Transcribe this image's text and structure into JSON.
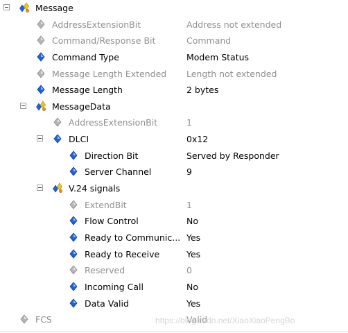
{
  "watermark": "https://blog.csdn.net/XiaoXiaoPengBo",
  "rows": [
    {
      "label": "Message",
      "value": "",
      "icon": "group-icon",
      "dim": false,
      "expander": true
    },
    {
      "label": "AddressExtensionBit",
      "value": "Address not extended",
      "icon": "gray-diamond-icon",
      "dim": true
    },
    {
      "label": "Command/Response Bit",
      "value": "Command",
      "icon": "gray-diamond-icon",
      "dim": true
    },
    {
      "label": "Command Type",
      "value": "Modem Status",
      "icon": "blue-diamond-icon",
      "dim": false
    },
    {
      "label": "Message Length Extended",
      "value": "Length not extended",
      "icon": "gray-diamond-icon",
      "dim": true
    },
    {
      "label": "Message Length",
      "value": "2 bytes",
      "icon": "blue-diamond-icon",
      "dim": false
    },
    {
      "label": "MessageData",
      "value": "",
      "icon": "group-icon",
      "dim": false,
      "expander": true
    },
    {
      "label": "AddressExtensionBit",
      "value": "1",
      "icon": "gray-diamond-icon",
      "dim": true
    },
    {
      "label": "DLCI",
      "value": "0x12",
      "icon": "blue-diamond-icon",
      "dim": false,
      "expander": true
    },
    {
      "label": "Direction Bit",
      "value": "Served by Responder",
      "icon": "blue-diamond-icon",
      "dim": false
    },
    {
      "label": "Server Channel",
      "value": "9",
      "icon": "blue-diamond-icon",
      "dim": false
    },
    {
      "label": "V.24 signals",
      "value": "",
      "icon": "group-icon",
      "dim": false,
      "expander": true
    },
    {
      "label": "ExtendBit",
      "value": "1",
      "icon": "gray-diamond-icon",
      "dim": true
    },
    {
      "label": "Flow Control",
      "value": "No",
      "icon": "blue-diamond-icon",
      "dim": false
    },
    {
      "label": "Ready to Communic...",
      "value": "Yes",
      "icon": "blue-diamond-icon",
      "dim": false
    },
    {
      "label": "Ready to Receive",
      "value": "Yes",
      "icon": "blue-diamond-icon",
      "dim": false
    },
    {
      "label": "Reserved",
      "value": "0",
      "icon": "gray-diamond-icon",
      "dim": true
    },
    {
      "label": "Incoming Call",
      "value": "No",
      "icon": "blue-diamond-icon",
      "dim": false
    },
    {
      "label": "Data Valid",
      "value": "Yes",
      "icon": "blue-diamond-icon",
      "dim": false
    },
    {
      "label": "FCS",
      "value": "Valid",
      "icon": "gray-diamond-icon",
      "dim": true
    }
  ]
}
